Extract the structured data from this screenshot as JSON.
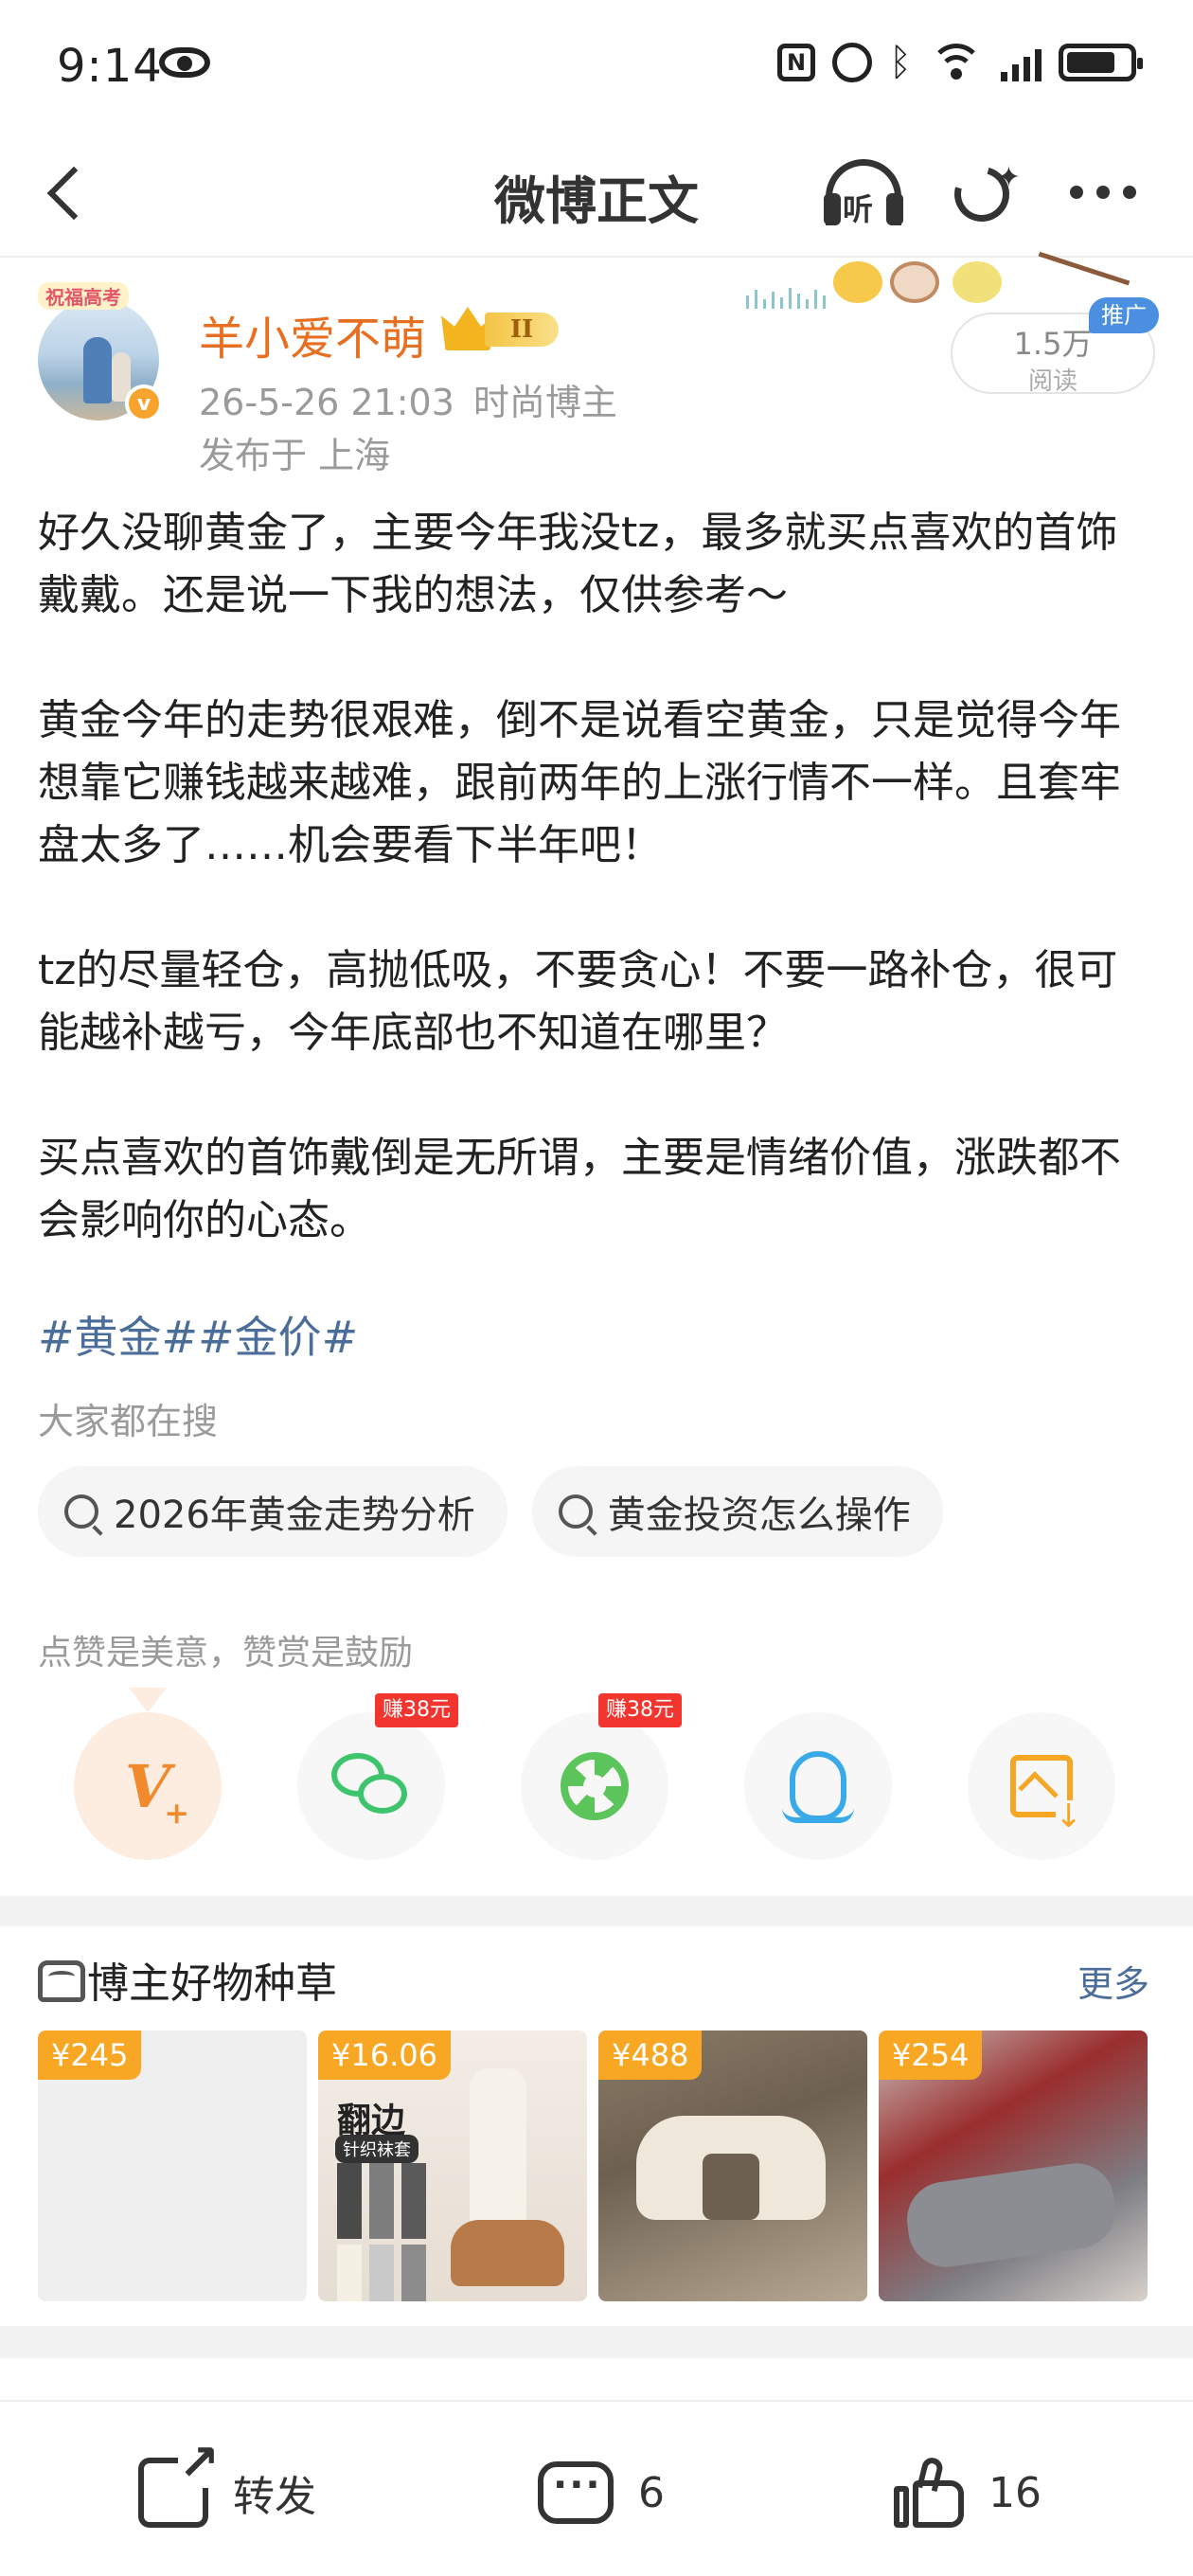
{
  "status_bar": {
    "time": "9:14",
    "icons": [
      "eye-icon",
      "nfc-icon",
      "alarm-icon",
      "bluetooth-icon",
      "wifi-icon",
      "signal-icon",
      "battery-icon"
    ]
  },
  "nav": {
    "title": "微博正文",
    "listen_label": "听"
  },
  "post": {
    "author": {
      "name": "羊小爱不萌",
      "vip_level": "II",
      "avatar_frame_text": "祝福高考"
    },
    "time": "26-5-26 21:03",
    "role": "时尚博主",
    "location": "发布于 上海",
    "reads": {
      "count": "1.5万",
      "label": "阅读",
      "promo": "推广"
    },
    "paragraphs": [
      "好久没聊黄金了，主要今年我没tz，最多就买点喜欢的首饰戴戴。还是说一下我的想法，仅供参考～",
      "黄金今年的走势很艰难，倒不是说看空黄金，只是觉得今年想靠它赚钱越来越难，跟前两年的上涨行情不一样。且套牢盘太多了……机会要看下半年吧！",
      "tz的尽量轻仓，高抛低吸，不要贪心！不要一路补仓，很可能越补越亏，今年底部也不知道在哪里？",
      "买点喜欢的首饰戴倒是无所谓，主要是情绪价值，涨跌都不会影响你的心态。"
    ],
    "hashtags": [
      "#黄金#",
      "#金价#"
    ]
  },
  "hot_search": {
    "heading": "大家都在搜",
    "chips": [
      "2026年黄金走势分析",
      "黄金投资怎么操作"
    ]
  },
  "reward": {
    "note": "点赞是美意，赞赏是鼓励",
    "earn_badge": "赚38元"
  },
  "goods": {
    "title": "博主好物种草",
    "more": "更多",
    "items": [
      {
        "price": "¥245"
      },
      {
        "price": "¥16.06",
        "image_text": "翻边",
        "image_subtext": "针织袜套"
      },
      {
        "price": "¥488"
      },
      {
        "price": "¥254"
      }
    ]
  },
  "bottom_bar": {
    "repost_label": "转发",
    "comment_count": "6",
    "like_count": "16"
  },
  "colors": {
    "username": "#e86f21",
    "link": "#4a6d99",
    "price_tag": "#f8a724",
    "earn_badge": "#f2352f",
    "promo": "#4a8fe0"
  }
}
